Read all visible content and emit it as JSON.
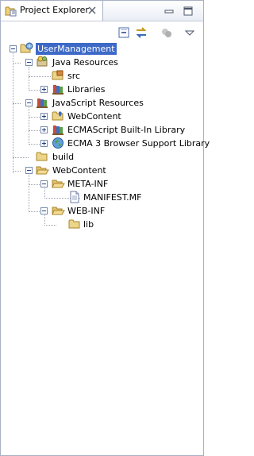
{
  "view": {
    "tab_title": "Project Explorer",
    "tab_icon": "folder-explorer-icon",
    "close_icon": "close-icon",
    "minimize_icon": "minimize-icon",
    "maximize_icon": "maximize-icon"
  },
  "toolbar": {
    "collapse_all_icon": "collapse-all-icon",
    "link_with_editor_icon": "link-with-editor-icon",
    "view_menu_icon": "view-menu-icon",
    "disabled_icon": "filters-icon"
  },
  "tree": {
    "project": "UserManagement",
    "java_resources": "Java Resources",
    "src": "src",
    "libraries": "Libraries",
    "js_resources": "JavaScript Resources",
    "js_webcontent": "WebContent",
    "ecma_builtin": "ECMAScript Built-In Library",
    "ecma3_browser": "ECMA 3 Browser Support Library",
    "build": "build",
    "webcontent": "WebContent",
    "meta_inf": "META-INF",
    "manifest": "MANIFEST.MF",
    "web_inf": "WEB-INF",
    "lib": "lib"
  },
  "colors": {
    "selection": "#3d69c7",
    "folder": "#e8c66a",
    "border": "#a9b0c3"
  }
}
